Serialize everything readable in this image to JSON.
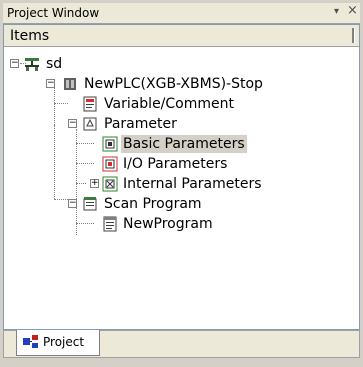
{
  "window": {
    "title": "Project Window",
    "pin_glyph": "▾",
    "close_glyph": "×"
  },
  "header": {
    "label": "Items"
  },
  "tree": [
    {
      "label": "sd",
      "icon": "network-icon",
      "expander": "−"
    },
    {
      "label": "NewPLC(XGB-XBMS)-Stop",
      "icon": "plc-icon",
      "expander": "−"
    },
    {
      "label": "Variable/Comment",
      "icon": "variable-comment-icon"
    },
    {
      "label": "Parameter",
      "icon": "parameter-icon",
      "expander": "−"
    },
    {
      "label": "Basic Parameters",
      "icon": "basic-parameters-icon",
      "selected": true
    },
    {
      "label": "I/O Parameters",
      "icon": "io-parameters-icon"
    },
    {
      "label": "Internal Parameters",
      "icon": "internal-parameters-icon",
      "expander": "+"
    },
    {
      "label": "Scan Program",
      "icon": "scan-program-icon",
      "expander": "−"
    },
    {
      "label": "NewProgram",
      "icon": "program-icon"
    }
  ],
  "tabs": [
    {
      "label": "Project",
      "icon": "project-tab-icon"
    }
  ],
  "colors": {
    "selection": "#d4d0c8",
    "panel_border": "#7f9db9",
    "chrome": "#ece9d8"
  }
}
